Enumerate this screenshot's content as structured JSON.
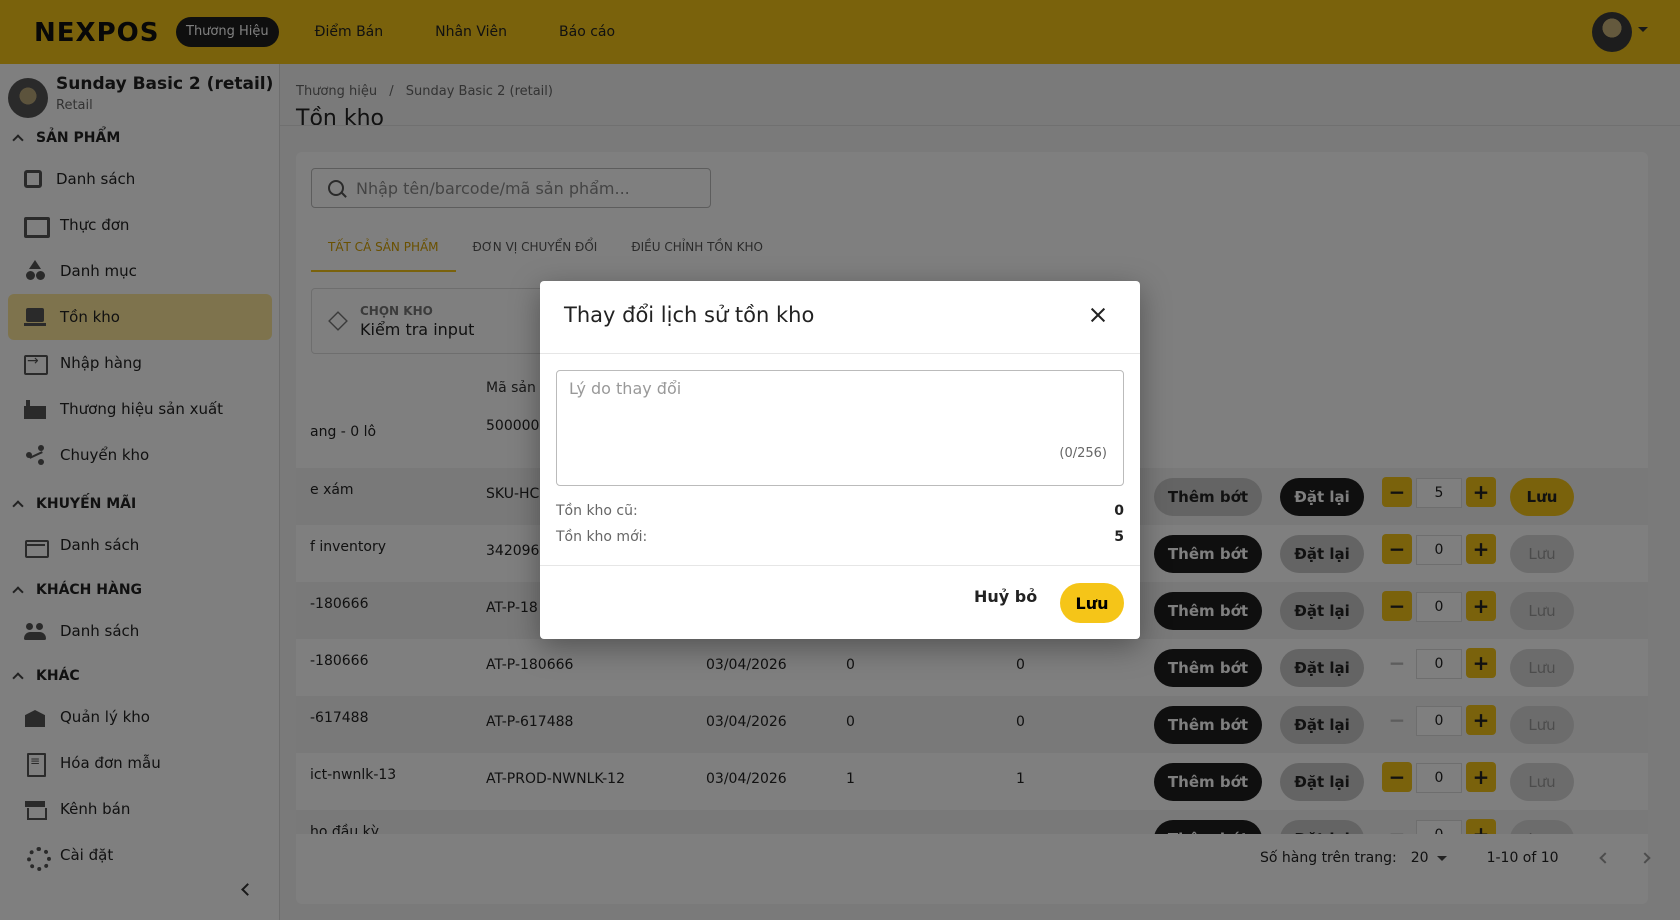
{
  "topbar": {
    "logo": "NEXPOS",
    "nav": [
      "Thương Hiệu",
      "Điểm Bán",
      "Nhân Viên",
      "Báo cáo"
    ],
    "active_nav": 0
  },
  "sidebar": {
    "store_name": "Sunday Basic 2 (retail)",
    "store_type": "Retail",
    "sections": {
      "products": "SẢN PHẨM",
      "promotions": "KHUYẾN MÃI",
      "customers": "KHÁCH HÀNG",
      "other": "KHÁC"
    },
    "items": {
      "product_list": "Danh sách",
      "menu": "Thực đơn",
      "category": "Danh mục",
      "inventory": "Tồn kho",
      "import": "Nhập hàng",
      "brand": "Thương hiệu sản xuất",
      "transfer": "Chuyển kho",
      "promo_list": "Danh sách",
      "customer_list": "Danh sách",
      "warehouse": "Quản lý kho",
      "invoice": "Hóa đơn mẫu",
      "channel": "Kênh bán",
      "settings": "Cài đặt"
    }
  },
  "main": {
    "breadcrumb": [
      "Thương hiệu",
      "/",
      "Sunday Basic 2 (retail)"
    ],
    "title": "Tồn kho",
    "search_placeholder": "Nhập tên/barcode/mã sản phẩm...",
    "tabs": [
      "TẤT CẢ SẢN PHẨM",
      "ĐƠN VỊ CHUYỂN ĐỔI",
      "ĐIỀU CHỈNH TỒN KHO"
    ],
    "warehouse_label": "CHỌN KHO",
    "warehouse_value": "Kiểm tra input",
    "column_sku": "Mã sản",
    "row0": {
      "name": "ang - 0 lô",
      "sku": "500000"
    },
    "rows": [
      {
        "name": "e xám",
        "sku": "SKU-HC",
        "date": "",
        "a": "",
        "b": "",
        "qty": "5",
        "minus": true,
        "save": true,
        "adjust_dark": false,
        "reset_dark": true
      },
      {
        "name": "f inventory",
        "sku": "342096",
        "date": "",
        "a": "",
        "b": "",
        "qty": "0",
        "minus": true,
        "save": false,
        "adjust_dark": true,
        "reset_dark": false
      },
      {
        "name": "-180666",
        "sku": "AT-P-18",
        "date": "",
        "a": "",
        "b": "",
        "qty": "0",
        "minus": true,
        "save": false,
        "adjust_dark": true,
        "reset_dark": false
      },
      {
        "name": "-180666",
        "sku": "AT-P-180666",
        "date": "03/04/2026",
        "a": "0",
        "b": "0",
        "qty": "0",
        "minus": false,
        "save": false,
        "adjust_dark": true,
        "reset_dark": false
      },
      {
        "name": "-617488",
        "sku": "AT-P-617488",
        "date": "03/04/2026",
        "a": "0",
        "b": "0",
        "qty": "0",
        "minus": false,
        "save": false,
        "adjust_dark": true,
        "reset_dark": false
      },
      {
        "name": "ict-nwnlk-13",
        "sku": "AT-PROD-NWNLK-12",
        "date": "03/04/2026",
        "a": "1",
        "b": "1",
        "qty": "0",
        "minus": true,
        "save": false,
        "adjust_dark": true,
        "reset_dark": false
      },
      {
        "name": "ho đầu kỳ",
        "sku": "",
        "date": "",
        "a": "",
        "b": "",
        "qty": "0",
        "minus": false,
        "save": false,
        "adjust_dark": true,
        "reset_dark": false
      }
    ],
    "btn_adjust": "Thêm bớt",
    "btn_reset": "Đặt lại",
    "btn_save": "Lưu",
    "footer": {
      "rows_per_page_label": "Số hàng trên trang:",
      "rows_per_page": "20",
      "range": "1-10 of 10"
    }
  },
  "modal": {
    "title": "Thay đổi lịch sử tồn kho",
    "reason_placeholder": "Lý do thay đổi",
    "counter": "(0/256)",
    "old_label": "Tồn kho cũ:",
    "old_value": "0",
    "new_label": "Tồn kho mới:",
    "new_value": "5",
    "cancel": "Huỷ bỏ",
    "save": "Lưu"
  },
  "colors": {
    "accent": "#f5c518",
    "dark": "#1e1e1e"
  }
}
